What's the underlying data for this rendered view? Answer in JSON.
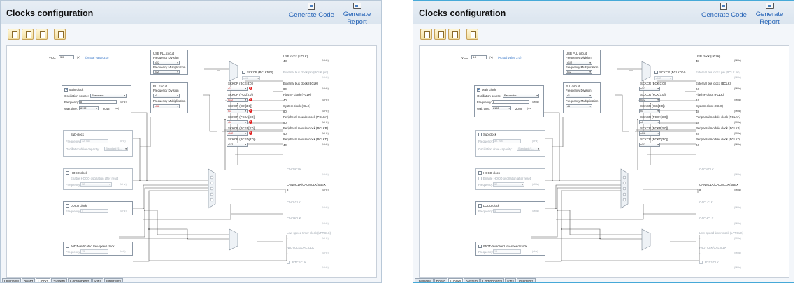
{
  "panels": [
    {
      "title": "Clocks configuration",
      "generate_code": "Generate Code",
      "generate_report": "Generate Report",
      "vcc": {
        "label": "VCC:",
        "value": "3.0",
        "unit": "(V)",
        "actual": "(Actual value 3.0)"
      },
      "main_clock": {
        "label": "Main clock",
        "osc_label": "Oscillation source:",
        "osc_value": "Resonator",
        "freq_label": "Frequency:",
        "freq_value": "8",
        "freq_unit": "(MHz)",
        "wait_label": "Wait time:",
        "wait_value": "8192",
        "wait_cycles": "2048",
        "wait_unit": "(us)"
      },
      "sub_clock": {
        "label": "Sub-clock",
        "freq_label": "Frequency:",
        "freq_value": "32.768",
        "freq_unit": "(kHz)",
        "drive_label": "Oscillation drive capacity:",
        "drive_value": "Standard (1..."
      },
      "hoco": {
        "label": "HOCO clock",
        "enable_label": "Enable HOCO oscillation after reset",
        "freq_label": "Frequency:",
        "freq_value": "32",
        "freq_unit": "(MHz)"
      },
      "loco": {
        "label": "LOCO clock",
        "freq_label": "Frequency:",
        "freq_value": "4",
        "freq_unit": "(MHz)"
      },
      "iwdt": {
        "label": "IWDT-dedicated low-speed clock",
        "freq_label": "Frequency:",
        "freq_value": "15",
        "freq_unit": "(kHz)"
      },
      "usb_pll": {
        "title": "USB PLL circuit",
        "div_label": "Frequency Division",
        "div_value": "x1/2",
        "mul_label": "Frequency Multiplication",
        "mul_value": "x12"
      },
      "pll": {
        "title": "PLL circuit",
        "div_label": "Frequency Division",
        "div_value": "x1",
        "mul_label": "Frequency Multiplication",
        "mul_value": "x16"
      },
      "divisors": [
        {
          "label": "SCKCR (BCK[3:0])",
          "value": "x1",
          "out_label": "External bus clock (BCLK)",
          "out_value": "80"
        },
        {
          "label": "SCKCR (FCK[3:0])",
          "value": "x1/2",
          "out_label": "FlashIF clock (FCLK)",
          "out_value": "40"
        },
        {
          "label": "SCKCR (ICK[3:0])",
          "value": "x1",
          "out_label": "System clock (ICLK)",
          "out_value": "80"
        },
        {
          "label": "SCKCR (PCKA[3:0])",
          "value": "x1",
          "out_label": "Peripheral module clock (PCLKA)",
          "out_value": "80"
        },
        {
          "label": "SCKCR (PCKB[3:0])",
          "value": "x1/2",
          "out_label": "Peripheral module clock (PCLKB)",
          "out_value": "40"
        },
        {
          "label": "SCKCR (PCKD[3:0])",
          "value": "x1/2",
          "out_label": "Peripheral module clock (PCLKD)",
          "out_value": "40"
        }
      ],
      "errors": [
        true,
        true,
        true,
        true,
        true,
        false
      ]
    },
    {
      "title": "Clocks configuration",
      "generate_code": "Generate Code",
      "generate_report": "Generate Report",
      "vcc": {
        "label": "VCC:",
        "value": "3.0",
        "unit": "(V)",
        "actual": "(Actual value 3.0)"
      },
      "main_clock": {
        "label": "Main clock",
        "osc_label": "Oscillation source:",
        "osc_value": "Resonator",
        "freq_label": "Frequency:",
        "freq_value": "8",
        "freq_unit": "(MHz)",
        "wait_label": "Wait time:",
        "wait_value": "8192",
        "wait_cycles": "2048",
        "wait_unit": "(us)"
      },
      "sub_clock": {
        "label": "Sub-clock",
        "freq_label": "Frequency:",
        "freq_value": "32.768",
        "freq_unit": "(kHz)",
        "drive_label": "Oscillation drive capacity:",
        "drive_value": "Standard (1..."
      },
      "hoco": {
        "label": "HOCO clock",
        "enable_label": "Enable HOCO oscillation after reset",
        "freq_label": "Frequency:",
        "freq_value": "32",
        "freq_unit": "(MHz)"
      },
      "loco": {
        "label": "LOCO clock",
        "freq_label": "Frequency:",
        "freq_value": "4",
        "freq_unit": "(MHz)"
      },
      "iwdt": {
        "label": "IWDT-dedicated low-speed clock",
        "freq_label": "Frequency:",
        "freq_value": "15",
        "freq_unit": "(kHz)"
      },
      "usb_pll": {
        "title": "USB PLL circuit",
        "div_label": "Frequency Division",
        "div_value": "x1/2",
        "mul_label": "Frequency Multiplication",
        "mul_value": "x12"
      },
      "pll": {
        "title": "PLL circuit",
        "div_label": "Frequency Division",
        "div_value": "x1",
        "mul_label": "Frequency Multiplication",
        "mul_value": "x6"
      },
      "divisors": [
        {
          "label": "SCKCR (BCK[3:0])",
          "value": "x1/2",
          "out_label": "External bus clock (BCLK)",
          "out_value": "24"
        },
        {
          "label": "SCKCR (FCK[3:0])",
          "value": "x1/2",
          "out_label": "FlashIF clock (FCLK)",
          "out_value": "24"
        },
        {
          "label": "SCKCR (ICK[3:0])",
          "value": "x1",
          "out_label": "System clock (ICLK)",
          "out_value": "48"
        },
        {
          "label": "SCKCR (PCKA[3:0])",
          "value": "x1",
          "out_label": "Peripheral module clock (PCLKA)",
          "out_value": "48"
        },
        {
          "label": "SCKCR (PCKB[3:0])",
          "value": "x1/2",
          "out_label": "Peripheral module clock (PCLKB)",
          "out_value": "24"
        },
        {
          "label": "SCKCR (PCKD[3:0])",
          "value": "x1/2",
          "out_label": "Peripheral module clock (PCLKD)",
          "out_value": "24"
        }
      ],
      "errors": [
        false,
        false,
        false,
        false,
        false,
        false
      ]
    }
  ],
  "shared": {
    "mhz": "(MHz)",
    "usb_clock": {
      "label": "USB clock (UCLK)",
      "value": "48"
    },
    "bclk_pin": {
      "label": "SCKCR (BCLKDIV)",
      "value": "x1/2",
      "out_label": "External bus clock pin (BCLK pin)",
      "out_value": "-"
    },
    "cac": {
      "label": "CACMCLK",
      "value": "-"
    },
    "can": {
      "label": "CANMCLK/CACMCLK/SBEX",
      "value": "8"
    },
    "cacl": {
      "label": "CACLCLK",
      "value": "-"
    },
    "cach": {
      "label": "CACHCLK",
      "value": "-"
    },
    "lpt": {
      "label": "Low-speed timer clock (LPTCLK)",
      "value": "-"
    },
    "iwdt_cac": {
      "label": "IWDTCLK/CACICLK",
      "value": "-"
    },
    "rtc": {
      "label": "RTCSCLK",
      "value": "-"
    }
  },
  "tabs": [
    "Overview",
    "Board",
    "Clocks",
    "System",
    "Components",
    "Pins",
    "Interrupts"
  ],
  "active_tab": "Clocks"
}
